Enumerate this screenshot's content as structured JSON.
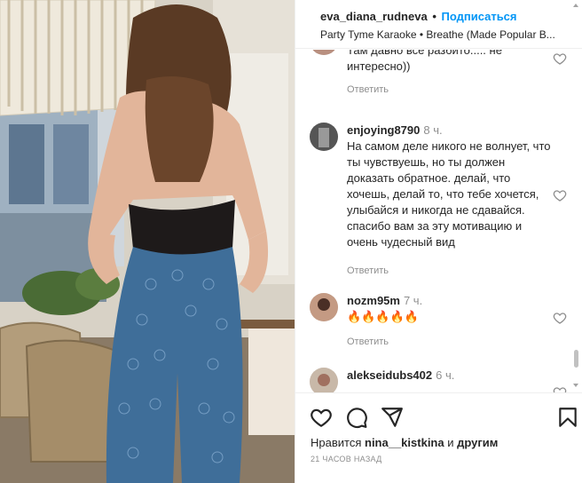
{
  "header": {
    "username": "eva_diana_rudneva",
    "separator": "•",
    "follow_label": "Подписаться",
    "audio": "Party Tyme Karaoke • Breathe (Made Popular B..."
  },
  "comments": [
    {
      "username": "",
      "time": "",
      "text": "Там давно все разбито..... не интересно))",
      "reply_label": "Ответить"
    },
    {
      "username": "enjoying8790",
      "time": "8 ч.",
      "text": "На самом деле никого не волнует, что ты чувствуешь, но ты должен доказать обратное. делай, что хочешь, делай то, что тебе хочется, улыбайся и никогда не сдавайся. спасибо вам за эту мотивацию и очень чудесный вид",
      "reply_label": "Ответить"
    },
    {
      "username": "nozm95m",
      "time": "7 ч.",
      "text": "🔥🔥🔥🔥🔥",
      "reply_label": "Ответить"
    },
    {
      "username": "alekseidubs402",
      "time": "6 ч.",
      "text": "",
      "reply_label": ""
    }
  ],
  "footer": {
    "likes_prefix": "Нравится",
    "likes_user": "nina__kistkina",
    "likes_conj": "и",
    "likes_others": "другим",
    "timestamp": "21 часов назад"
  },
  "icons": {
    "like": "heart-icon",
    "comment": "comment-icon",
    "share": "paper-plane-icon",
    "save": "bookmark-icon"
  },
  "colors": {
    "accent": "#0095f6",
    "text": "#262626",
    "muted": "#8e8e8e",
    "border": "#efefef"
  }
}
